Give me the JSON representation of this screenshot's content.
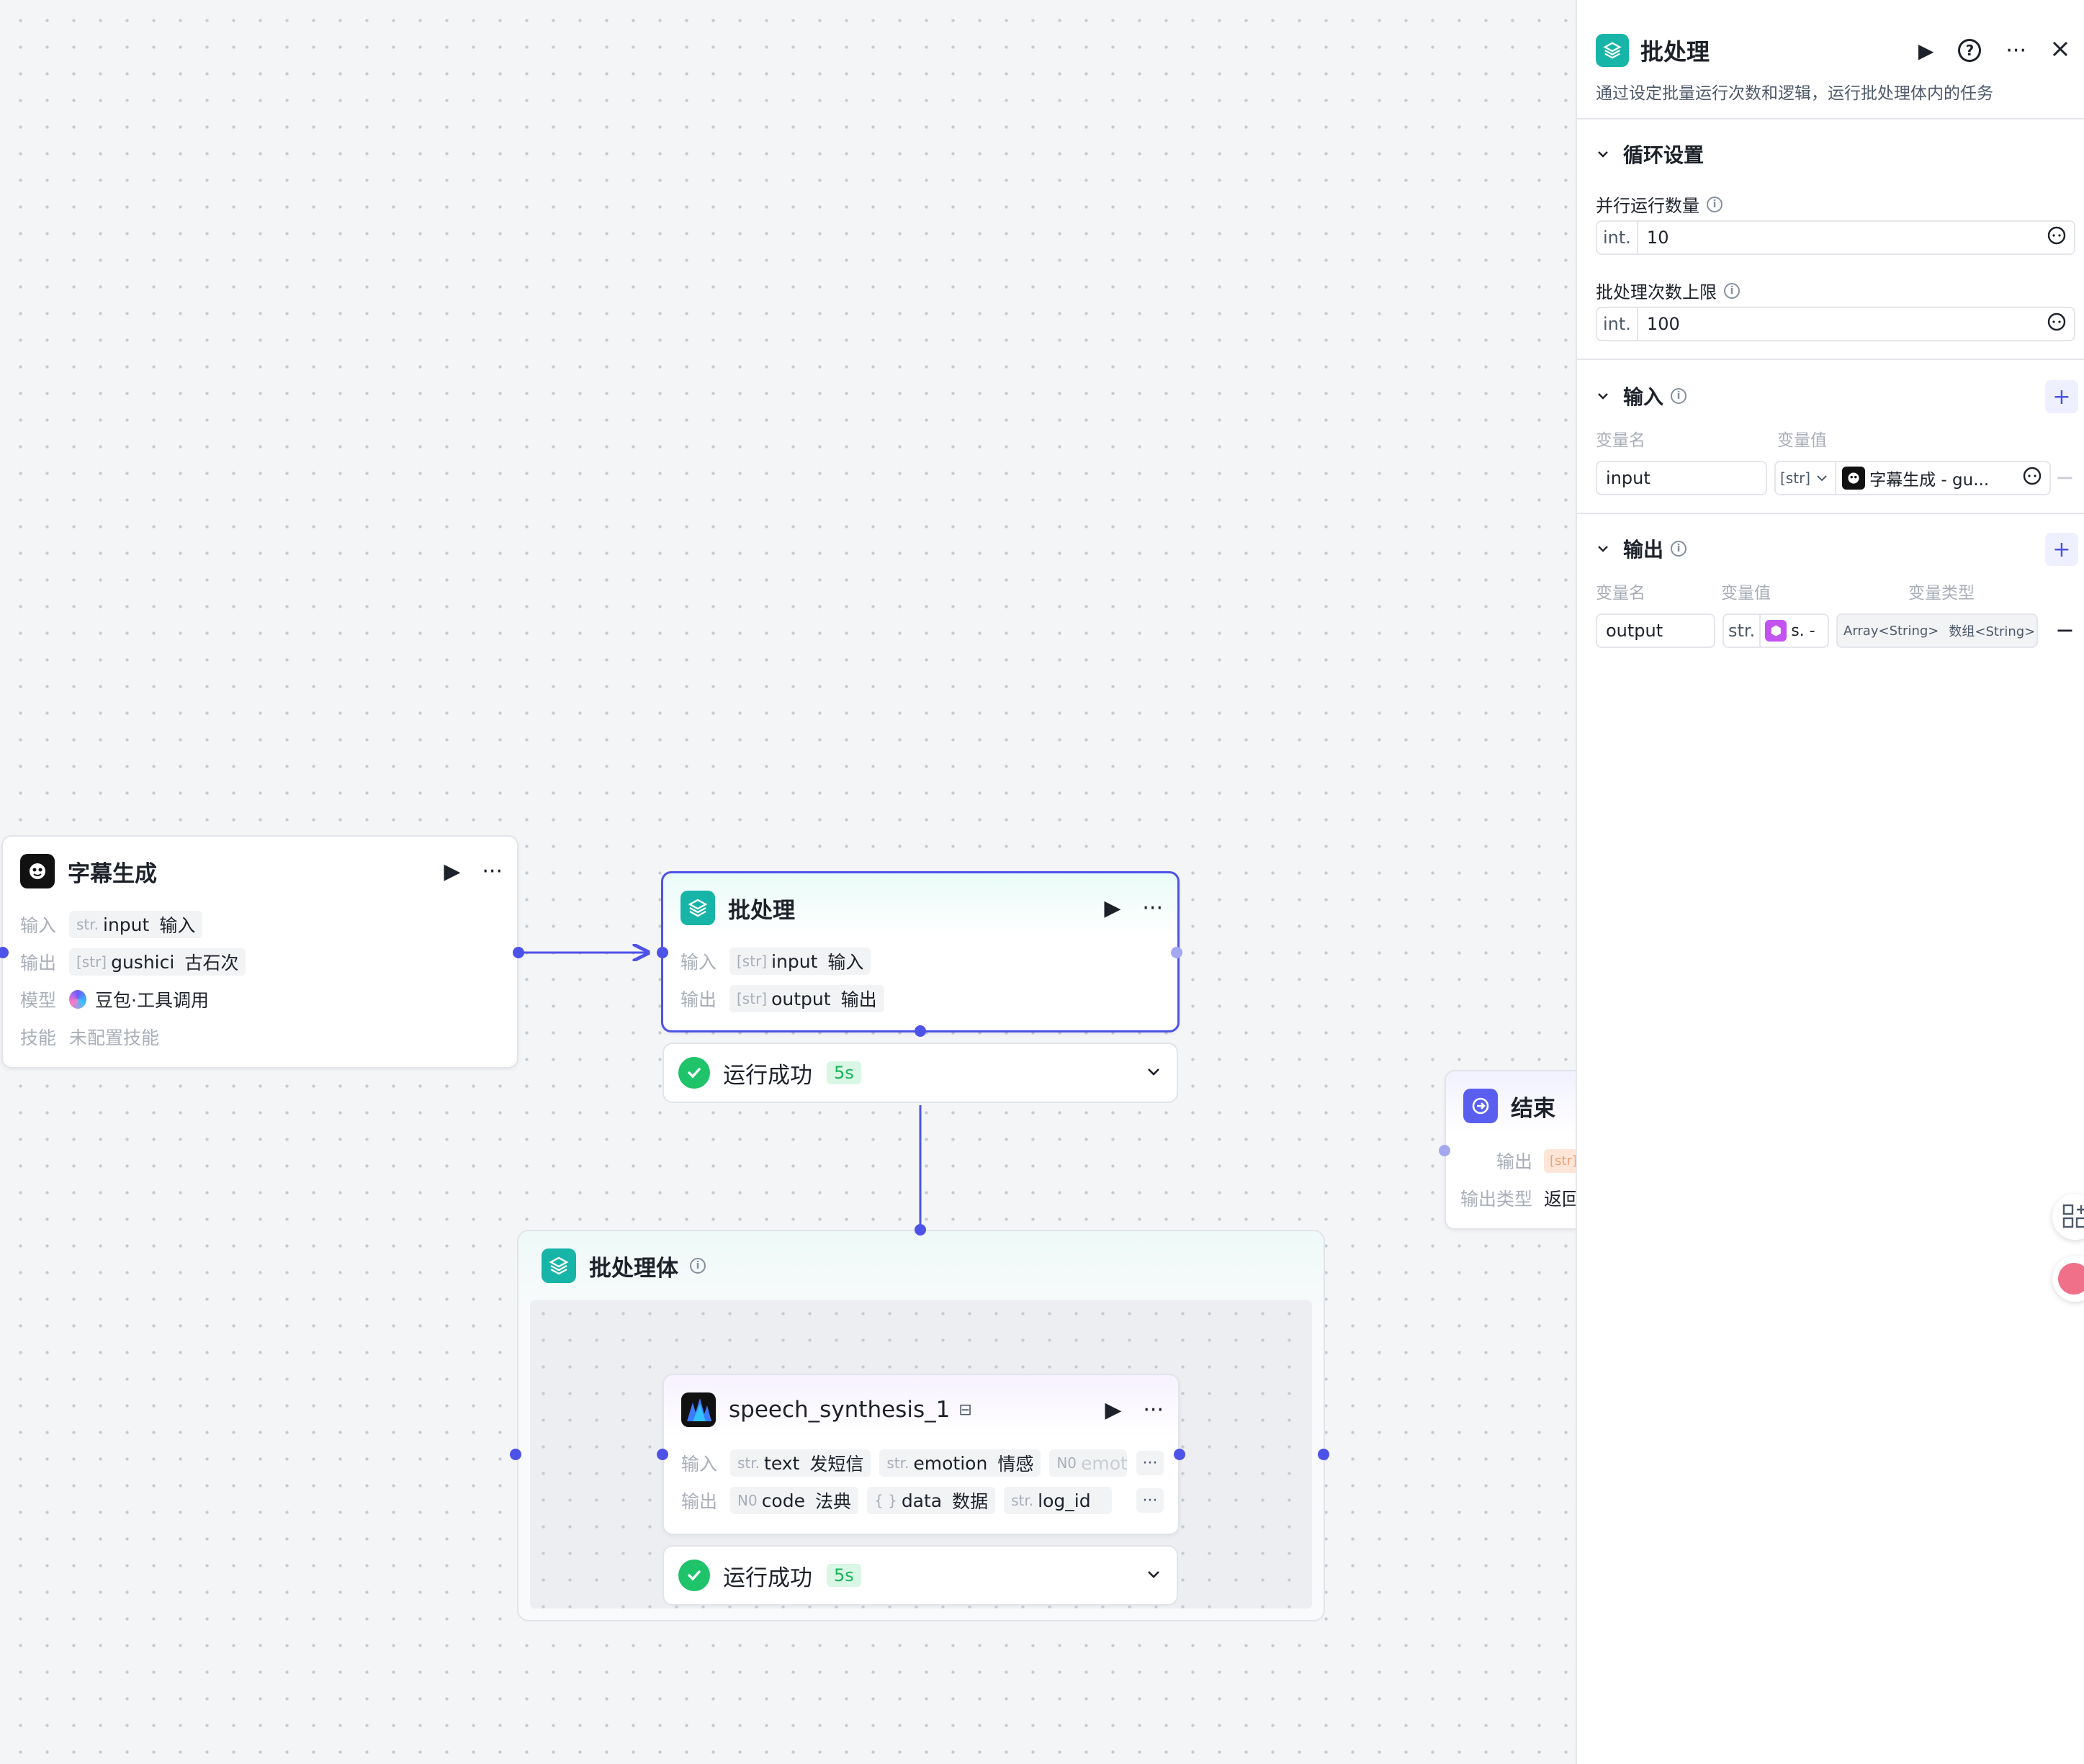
{
  "nodes": {
    "subtitle": {
      "title": "字幕生成",
      "rows": [
        {
          "label": "输入",
          "type": "str.",
          "name": "input",
          "desc": "输入"
        },
        {
          "label": "输出",
          "type": "[str]",
          "name": "gushici",
          "desc": "古石次"
        }
      ],
      "model_label": "模型",
      "model_value": "豆包·工具调用",
      "skill_label": "技能",
      "skill_value": "未配置技能"
    },
    "batch": {
      "title": "批处理",
      "rows": [
        {
          "label": "输入",
          "type": "[str]",
          "name": "input",
          "desc": "输入"
        },
        {
          "label": "输出",
          "type": "[str]",
          "name": "output",
          "desc": "输出"
        }
      ],
      "status": "运行成功",
      "duration": "5s"
    },
    "batch_body": {
      "title": "批处理体"
    },
    "speech": {
      "title": "speech_synthesis_1",
      "input_label": "输入",
      "inputs": [
        {
          "type": "str.",
          "name": "text",
          "desc": "发短信"
        },
        {
          "type": "str.",
          "name": "emotion",
          "desc": "情感"
        },
        {
          "type": "N0",
          "name": "emoti",
          "desc": ""
        }
      ],
      "output_label": "输出",
      "outputs": [
        {
          "type": "N0",
          "name": "code",
          "desc": "法典"
        },
        {
          "type": "{ }",
          "name": "data",
          "desc": "数据"
        },
        {
          "type": "str.",
          "name": "log_id",
          "desc": ""
        }
      ],
      "more": "···",
      "status": "运行成功",
      "duration": "5s"
    },
    "end": {
      "title": "结束",
      "output_label": "输出",
      "output_type_tag": "[str]",
      "output_type_label": "输出类型",
      "output_type_value": "返回"
    }
  },
  "panel": {
    "title": "批处理",
    "description": "通过设定批量运行次数和逻辑，运行批处理体内的任务",
    "loop_section": "循环设置",
    "parallel_label": "并行运行数量",
    "parallel_prefix": "int.",
    "parallel_value": "10",
    "limit_label": "批处理次数上限",
    "limit_prefix": "int.",
    "limit_value": "100",
    "input_section": "输入",
    "input_col_name": "变量名",
    "input_col_value": "变量值",
    "input_var_name": "input",
    "input_var_type": "[str]",
    "input_var_ref": "字幕生成 - gu...",
    "output_section": "输出",
    "output_col_name": "变量名",
    "output_col_value": "变量值",
    "output_col_type": "变量类型",
    "output_var_name": "output",
    "output_var_prefix": "str.",
    "output_var_ref": "s. -",
    "output_var_type": "Array<String>",
    "output_var_type_cn": "数组<String>"
  },
  "colors": {
    "accent": "#4d53e8",
    "success": "#1ec36a",
    "batch_icon": "#17b4a8",
    "end_icon": "#5b5ff0"
  }
}
